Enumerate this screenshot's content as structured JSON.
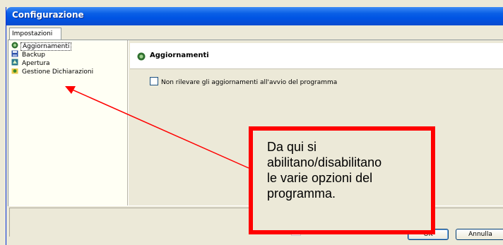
{
  "window": {
    "title": "Configurazione"
  },
  "tabs": [
    {
      "label": "Impostazioni"
    }
  ],
  "tree": {
    "items": [
      {
        "label": "Aggiornamenti",
        "icon": "update-icon",
        "selected": true
      },
      {
        "label": "Backup",
        "icon": "backup-icon"
      },
      {
        "label": "Apertura",
        "icon": "opening-icon"
      },
      {
        "label": "Gestione Dichiarazioni",
        "icon": "declarations-icon"
      }
    ]
  },
  "panel": {
    "title": "Aggiornamenti",
    "option_label": "Non rilevare gli aggiornamenti all'avvio del programma"
  },
  "buttons": {
    "ok": "OK",
    "cancel": "Annulla"
  },
  "callout": {
    "line1": "Da qui si",
    "line2": "abilitano/disabilitano",
    "line3": "le varie opzioni del",
    "line4": "programma."
  },
  "colors": {
    "callout_border": "#ff0000",
    "arrow": "#ff0000",
    "titlebar": "#0054e3"
  }
}
